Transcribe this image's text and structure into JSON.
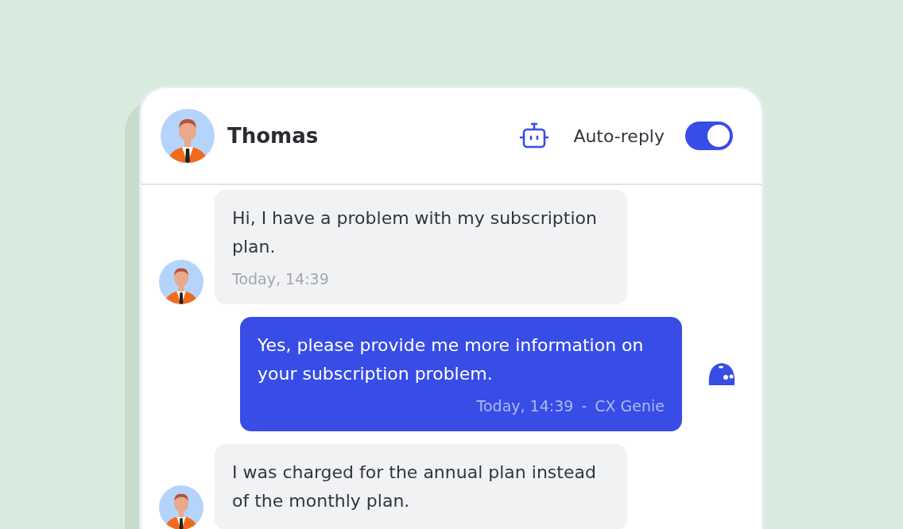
{
  "header": {
    "name": "Thomas",
    "auto_reply": {
      "label": "Auto-reply",
      "on": true
    }
  },
  "messages": [
    {
      "kind": "incoming",
      "text": "Hi, I have a problem with my subscription plan.",
      "time": "Today, 14:39"
    },
    {
      "kind": "outgoing",
      "text": "Yes, please provide me more information on your subscription problem.",
      "time": "Today, 14:39",
      "separator": "-",
      "sender": "CX Genie"
    },
    {
      "kind": "incoming",
      "text": "I was charged for the annual plan instead of the monthly plan."
    }
  ]
}
